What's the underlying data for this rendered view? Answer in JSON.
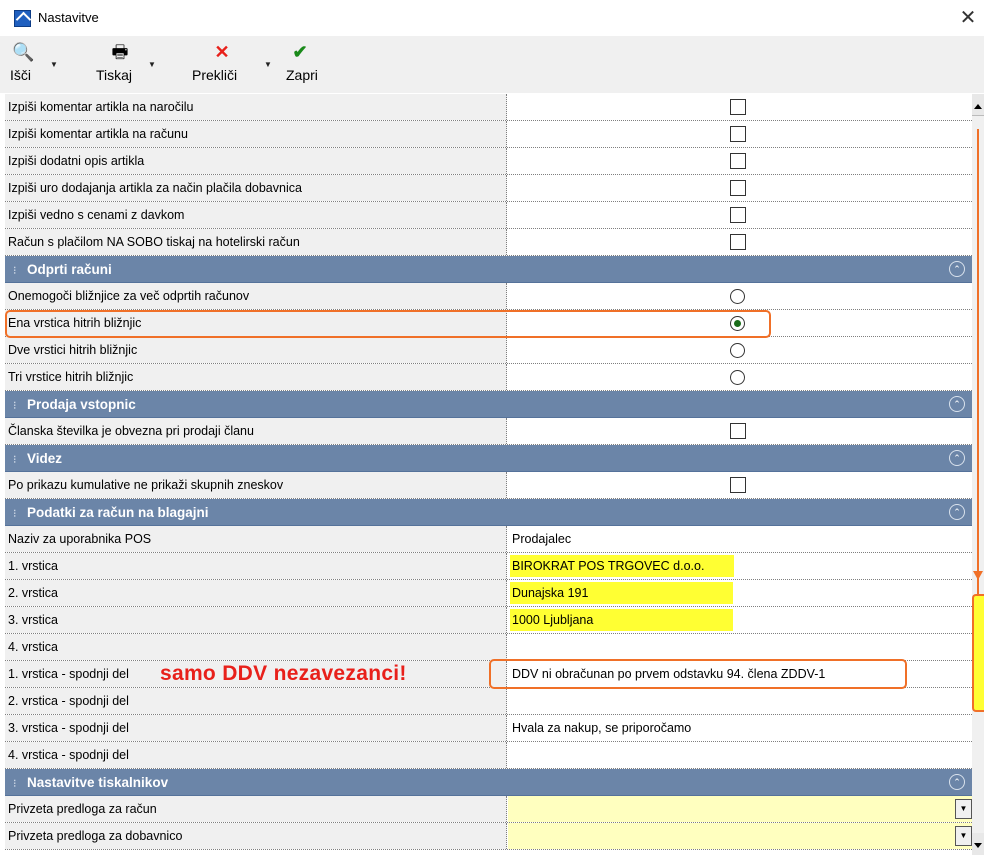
{
  "window": {
    "title": "Nastavitve"
  },
  "toolbar": {
    "search": "Išči",
    "print": "Tiskaj",
    "cancel": "Prekliči",
    "close": "Zapri"
  },
  "rows": {
    "r1": "Izpiši komentar artikla na naročilu",
    "r2": "Izpiši komentar artikla na računu",
    "r3": "Izpiši dodatni opis artikla",
    "r4": "Izpiši uro dodajanja artikla za način plačila dobavnica",
    "r5": "Izpiši vedno s cenami z davkom",
    "r6": "Račun s plačilom NA SOBO tiskaj na hotelirski račun",
    "sec_open": "Odprti računi",
    "r7": "Onemogoči bližnjice za več odprtih računov",
    "r8": "Ena vrstica hitrih bližnjic",
    "r9": "Dve vrstici hitrih bližnjic",
    "r10": "Tri vrstice hitrih bližnjic",
    "sec_tickets": "Prodaja vstopnic",
    "r11": "Članska številka je obvezna pri prodaji članu",
    "sec_view": "Videz",
    "r12": "Po prikazu kumulative ne prikaži skupnih zneskov",
    "sec_receipt": "Podatki za račun na blagajni",
    "r13": "Naziv za uporabnika POS",
    "r13_value": "Prodajalec",
    "r14": "1. vrstica",
    "r14_value": "BIROKRAT POS TRGOVEC d.o.o.",
    "r15": "2. vrstica",
    "r15_value": "Dunajska 191",
    "r16": "3. vrstica",
    "r16_value": "1000 Ljubljana",
    "r17": "4. vrstica",
    "r18": "1. vrstica - spodnji del",
    "r18_warning": "samo DDV nezavezanci!",
    "r18_value": "DDV ni obračunan po prvem odstavku 94. člena ZDDV-1",
    "r19": "2. vrstica - spodnji del",
    "r20": "3. vrstica - spodnji del",
    "r20_value": "Hvala za nakup, se priporočamo",
    "r21": "4. vrstica - spodnji del",
    "sec_printers": "Nastavitve tiskalnikov",
    "r22": "Privzeta predloga za račun",
    "r23": "Privzeta predloga za dobavnico"
  },
  "checks": {
    "r1": false,
    "r2": false,
    "r3": false,
    "r4": false,
    "r5": false,
    "r6": false,
    "r11": false,
    "r12": false
  },
  "radios": {
    "selected": "r8"
  },
  "colors": {
    "section": "#6b85a8",
    "highlight": "#ffff33",
    "annotation": "#f07028",
    "warning": "#e8201a"
  }
}
